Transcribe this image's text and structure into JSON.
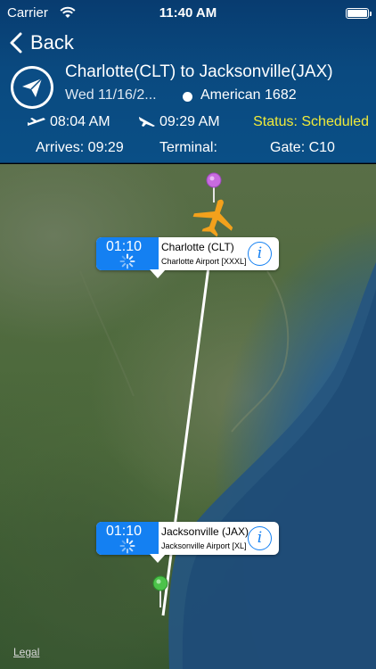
{
  "status_bar": {
    "carrier": "Carrier",
    "time": "11:40 AM"
  },
  "nav": {
    "back_label": "Back"
  },
  "flight": {
    "route": "Charlotte(CLT) to Jacksonville(JAX)",
    "date": "Wed 11/16/2...",
    "airline": "American 1682",
    "departure_time": "08:04 AM",
    "arrival_time": "09:29 AM",
    "status": "Status: Scheduled",
    "arrives": "Arrives: 09:29",
    "terminal": "Terminal:",
    "gate": "Gate: C10"
  },
  "map": {
    "origin_callout": {
      "eta": "01:10",
      "name": "Charlotte (CLT)",
      "airport": "Charlotte Airport [XXXL]"
    },
    "destination_callout": {
      "eta": "01:10",
      "name": "Jacksonville (JAX)",
      "airport": "Jacksonville Airport [XL]"
    },
    "legal": "Legal"
  },
  "colors": {
    "header_bg": "#0a4a80",
    "status_yellow": "#f0ea3a",
    "callout_blue": "#1480f2",
    "plane_orange": "#f3a11c",
    "origin_pin": "#c86be0",
    "destination_pin": "#4cc34a"
  },
  "icons": {
    "back": "chevron-left-icon",
    "flight_badge": "paper-plane-icon",
    "departure": "takeoff-icon",
    "arrival": "landing-icon",
    "info": "info-icon",
    "spinner": "loading-spinner-icon"
  }
}
